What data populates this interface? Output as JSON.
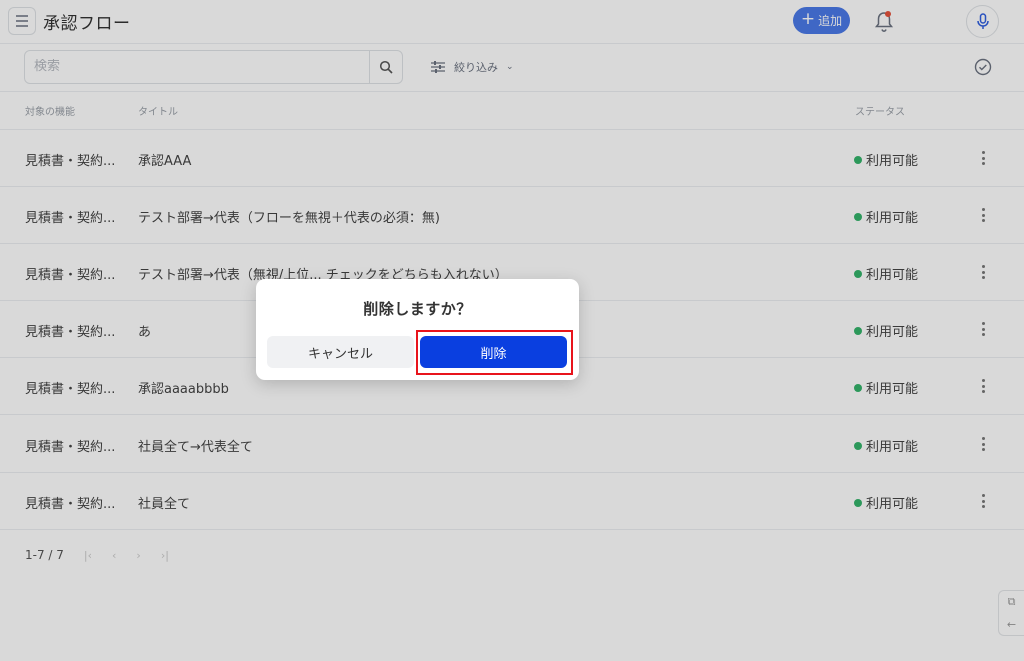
{
  "header": {
    "title": "承認フロー",
    "add_label": "追加",
    "icons": [
      "menu-icon",
      "plus-icon",
      "bell-icon",
      "mic-icon"
    ]
  },
  "toolbar": {
    "search_placeholder": "検索",
    "filter_label": "絞り込み"
  },
  "table": {
    "columns": [
      "対象の機能",
      "タイトル",
      "ステータス"
    ],
    "rows": [
      {
        "feature": "見積書・契約...",
        "title": "承認AAA",
        "status": "利用可能"
      },
      {
        "feature": "見積書・契約...",
        "title": "テスト部署→代表（フローを無視＋代表の必須：無)",
        "status": "利用可能"
      },
      {
        "feature": "見積書・契約...",
        "title": "テスト部署→代表（無視/上位... チェックをどちらも入れない）",
        "status": "利用可能"
      },
      {
        "feature": "見積書・契約...",
        "title": "あ",
        "status": "利用可能"
      },
      {
        "feature": "見積書・契約...",
        "title": "承認aaaabbbb",
        "status": "利用可能"
      },
      {
        "feature": "見積書・契約...",
        "title": "社員全て→代表全て",
        "status": "利用可能"
      },
      {
        "feature": "見積書・契約...",
        "title": "社員全て",
        "status": "利用可能"
      }
    ],
    "status_color": "#34b36a"
  },
  "pagination": {
    "range": "1-7 / 7"
  },
  "dialog": {
    "title": "削除しますか？",
    "cancel_label": "キャンセル",
    "delete_label": "削除"
  },
  "colors": {
    "primary": "#0a3fe0",
    "accent": "#4a7ae8",
    "highlight": "#e8141c"
  }
}
